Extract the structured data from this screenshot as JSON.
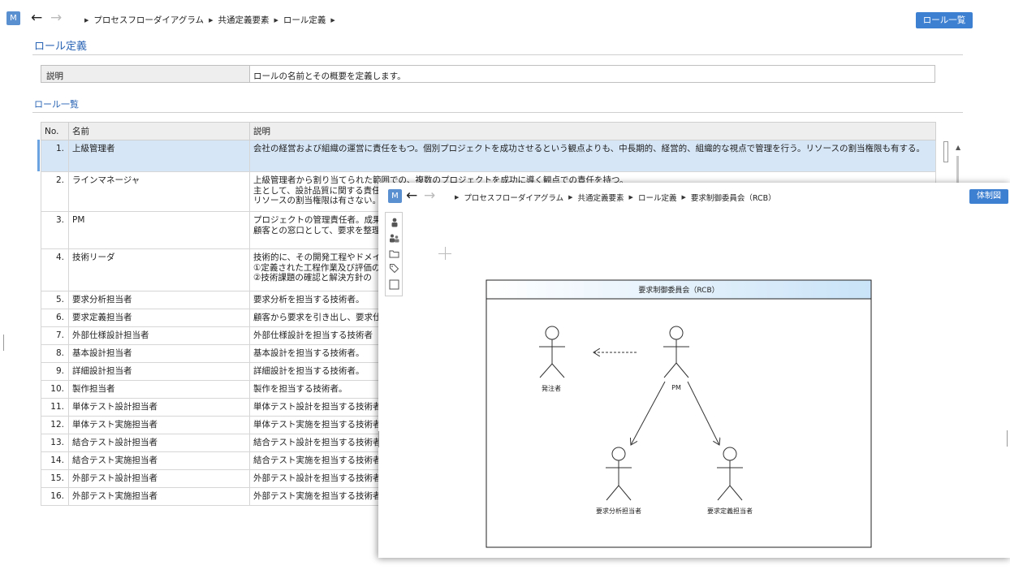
{
  "topbar": {
    "m_label": "M",
    "back_icon": "left-arrow-icon",
    "forward_icon": "right-arrow-icon",
    "breadcrumbs": [
      "プロセスフローダイアグラム",
      "共通定義要素",
      "ロール定義"
    ],
    "list_button": "ロール一覧"
  },
  "page": {
    "title": "ロール定義",
    "desc_label": "説明",
    "desc_value": "ロールの名前とその概要を定義します。",
    "list_title": "ロール一覧"
  },
  "table": {
    "headers": {
      "no": "No.",
      "name": "名前",
      "desc": "説明"
    },
    "rows": [
      {
        "no": "1.",
        "name": "上級管理者",
        "desc": [
          "会社の経営および組織の運営に責任をもつ。個別プロジェクトを成功させるという観点よりも、中長期的、経営的、組織的な視点で管理を行う。リソースの割当権限も有する。"
        ]
      },
      {
        "no": "2.",
        "name": "ラインマネージャ",
        "desc": [
          "上級管理者から割り当てられた範囲での、複数のプロジェクトを成功に導く観点での責任を持つ。",
          "主として、設計品質に関する責任",
          "リソースの割当権限は有さない。"
        ]
      },
      {
        "no": "3.",
        "name": "PM",
        "desc": [
          "プロジェクトの管理責任者。成果物",
          "顧客との窓口として、要求を整理し"
        ]
      },
      {
        "no": "4.",
        "name": "技術リーダ",
        "desc": [
          "技術的に、その開発工程やドメイン",
          "①定義された工程作業及び評価の",
          "②技術課題の確認と解決方針の"
        ]
      },
      {
        "no": "5.",
        "name": "要求分析担当者",
        "desc": [
          "要求分析を担当する技術者。"
        ]
      },
      {
        "no": "6.",
        "name": "要求定義担当者",
        "desc": [
          "顧客から要求を引き出し、要求仕"
        ]
      },
      {
        "no": "7.",
        "name": "外部仕様設計担当者",
        "desc": [
          "外部仕様設計を担当する技術者"
        ]
      },
      {
        "no": "8.",
        "name": "基本設計担当者",
        "desc": [
          "基本設計を担当する技術者。"
        ]
      },
      {
        "no": "9.",
        "name": "詳細設計担当者",
        "desc": [
          "詳細設計を担当する技術者。"
        ]
      },
      {
        "no": "10.",
        "name": "製作担当者",
        "desc": [
          "製作を担当する技術者。"
        ]
      },
      {
        "no": "11.",
        "name": "単体テスト設計担当者",
        "desc": [
          "単体テスト設計を担当する技術者"
        ]
      },
      {
        "no": "12.",
        "name": "単体テスト実施担当者",
        "desc": [
          "単体テスト実施を担当する技術者"
        ]
      },
      {
        "no": "13.",
        "name": "結合テスト設計担当者",
        "desc": [
          "結合テスト設計を担当する技術者"
        ]
      },
      {
        "no": "14.",
        "name": "結合テスト実施担当者",
        "desc": [
          "結合テスト実施を担当する技術者"
        ]
      },
      {
        "no": "15.",
        "name": "外部テスト設計担当者",
        "desc": [
          "外部テスト設計を担当する技術者"
        ]
      },
      {
        "no": "16.",
        "name": "外部テスト実施担当者",
        "desc": [
          "外部テスト実施を担当する技術者"
        ]
      }
    ]
  },
  "popup": {
    "m_label": "M",
    "breadcrumbs": [
      "プロセスフローダイアグラム",
      "共通定義要素",
      "ロール定義",
      "要求制御委員会（RCB）"
    ],
    "diagram_button": "体制図",
    "tools": [
      "actor-icon",
      "group-icon",
      "folder-icon",
      "tag-icon",
      "rectangle-icon"
    ],
    "diagram": {
      "frame_title": "要求制御委員会（RCB）",
      "actors": {
        "client": "発注者",
        "pm": "PM",
        "req_analysis": "要求分析担当者",
        "req_definition": "要求定義担当者"
      }
    }
  }
}
